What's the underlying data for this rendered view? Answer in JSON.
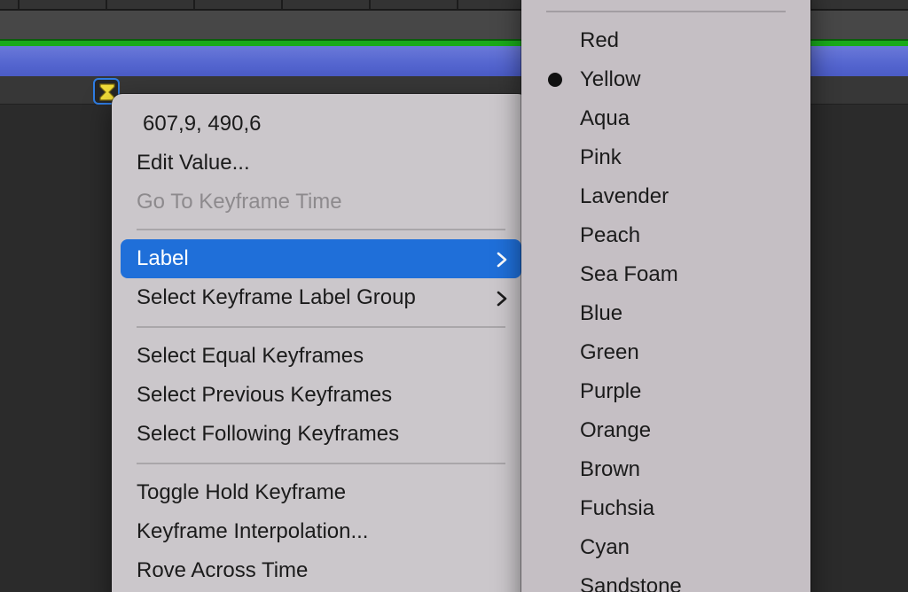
{
  "context_menu": {
    "value_readout": "607,9, 490,6",
    "edit_value": "Edit Value...",
    "go_to_keyframe_time": "Go To Keyframe Time",
    "label": "Label",
    "select_keyframe_label_group": "Select Keyframe Label Group",
    "select_equal_keyframes": "Select Equal Keyframes",
    "select_previous_keyframes": "Select Previous Keyframes",
    "select_following_keyframes": "Select Following Keyframes",
    "toggle_hold_keyframe": "Toggle Hold Keyframe",
    "keyframe_interpolation": "Keyframe Interpolation...",
    "rove_across_time": "Rove Across Time"
  },
  "label_submenu": {
    "selected": "Yellow",
    "items": [
      "Red",
      "Yellow",
      "Aqua",
      "Pink",
      "Lavender",
      "Peach",
      "Sea Foam",
      "Blue",
      "Green",
      "Purple",
      "Orange",
      "Brown",
      "Fuchsia",
      "Cyan",
      "Sandstone"
    ]
  },
  "colors": {
    "highlight": "#1f6fd9",
    "layer_bar": "#5465cf",
    "work_area": "#1aaa1a",
    "keyframe_fill": "#f2de3a",
    "keyframe_border": "#2f7de3"
  },
  "icons": {
    "keyframe": "hourglass-keyframe-icon",
    "submenu_arrow": "chevron-right-icon",
    "selected_mark": "bullet-icon"
  }
}
